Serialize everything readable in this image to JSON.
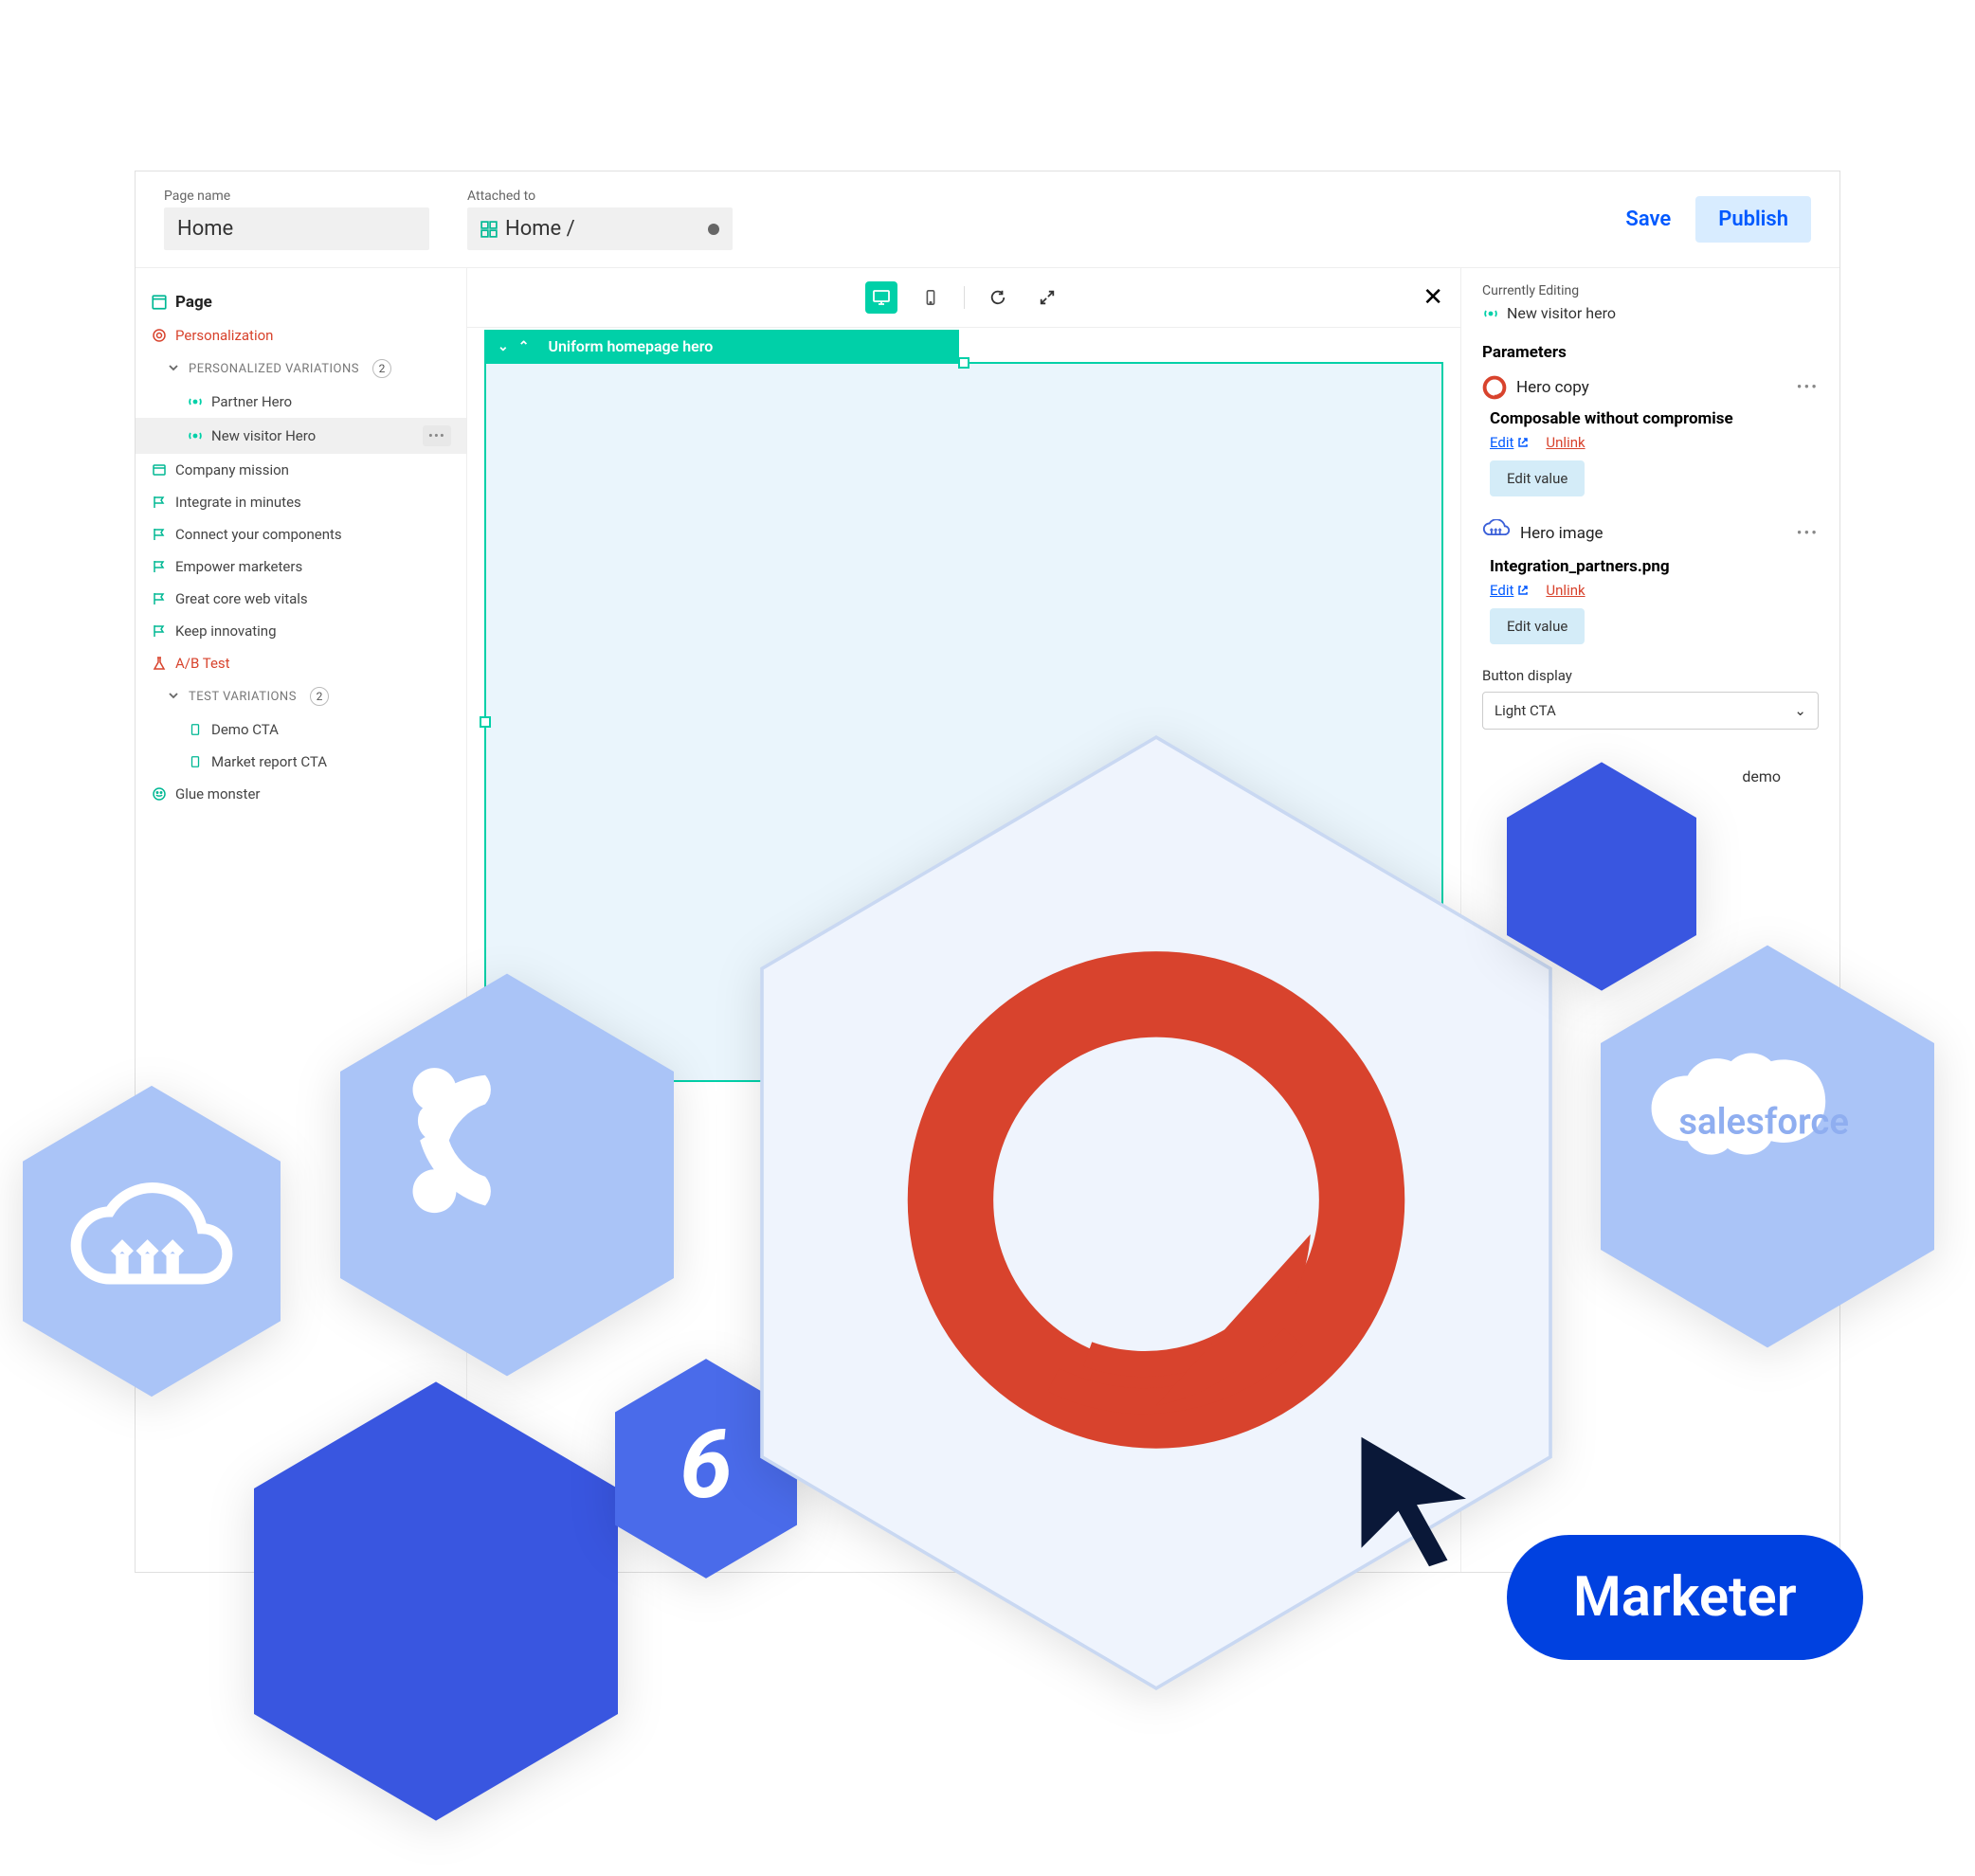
{
  "header": {
    "page_name_label": "Page name",
    "page_name_value": "Home",
    "attached_label": "Attached to",
    "attached_value": "Home /",
    "save": "Save",
    "publish": "Publish"
  },
  "tree": {
    "page": "Page",
    "personalization": "Personalization",
    "pv_label": "PERSONALIZED VARIATIONS",
    "pv_count": "2",
    "partner_hero": "Partner Hero",
    "new_visitor_hero": "New visitor Hero",
    "company_mission": "Company mission",
    "integrate": "Integrate in minutes",
    "connect": "Connect your components",
    "empower": "Empower marketers",
    "vitals": "Great core web vitals",
    "innovating": "Keep innovating",
    "ab_test": "A/B Test",
    "tv_label": "TEST VARIATIONS",
    "tv_count": "2",
    "demo_cta": "Demo CTA",
    "market_cta": "Market report CTA",
    "glue_monster": "Glue monster"
  },
  "canvas": {
    "block_label": "Uniform homepage hero"
  },
  "right": {
    "currently_editing": "Currently Editing",
    "editing_name": "New visitor hero",
    "parameters": "Parameters",
    "hero_copy": "Hero copy",
    "hero_copy_title": "Composable without compromise",
    "edit": "Edit",
    "unlink": "Unlink",
    "edit_value": "Edit value",
    "hero_image": "Hero image",
    "hero_image_file": "Integration_partners.png",
    "button_display_label": "Button display",
    "button_display_value": "Light CTA",
    "demo_label": "demo"
  },
  "overlay": {
    "salesforce": "salesforce",
    "marketer": "Marketer"
  }
}
